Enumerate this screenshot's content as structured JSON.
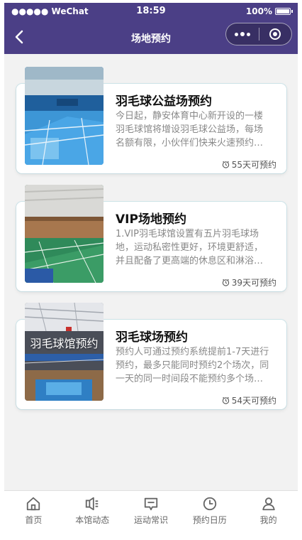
{
  "status_bar": {
    "carrier": "●●●●● WeChat",
    "time": "18:59",
    "battery": "100%"
  },
  "nav": {
    "title": "场地预约",
    "back_icon": "chevron-left-icon",
    "more_icon": "more-dots-icon",
    "close_icon": "target-circle-icon",
    "color": "#4b3f86"
  },
  "cards": [
    {
      "title": "羽毛球公益场预约",
      "description": "今日起，静安体育中心新开设的一楼羽毛球馆将增设羽毛球公益场，每场名额有限，小伙伴们快来火速预约吧！",
      "days": "55天可预约"
    },
    {
      "title": "VIP场地预约",
      "description": "1.VIP羽毛球馆设置有五片羽毛球场地，运动私密性更好，环境更舒适，并且配备了更高端的休息区和淋浴设施。",
      "days": "39天可预约"
    },
    {
      "title": "羽毛球场预约",
      "description": "预约人可通过预约系统提前1-7天进行预约，最多只能同时预约2个场次，同一天的同一时间段不能预约多个场地。",
      "days": "54天可预约",
      "image_caption": "羽毛球馆预约"
    }
  ],
  "tabs": [
    {
      "label": "首页",
      "icon": "home-icon"
    },
    {
      "label": "本馆动态",
      "icon": "speaker-icon"
    },
    {
      "label": "运动常识",
      "icon": "message-icon"
    },
    {
      "label": "预约日历",
      "icon": "clock-icon"
    },
    {
      "label": "我的",
      "icon": "user-icon"
    }
  ]
}
